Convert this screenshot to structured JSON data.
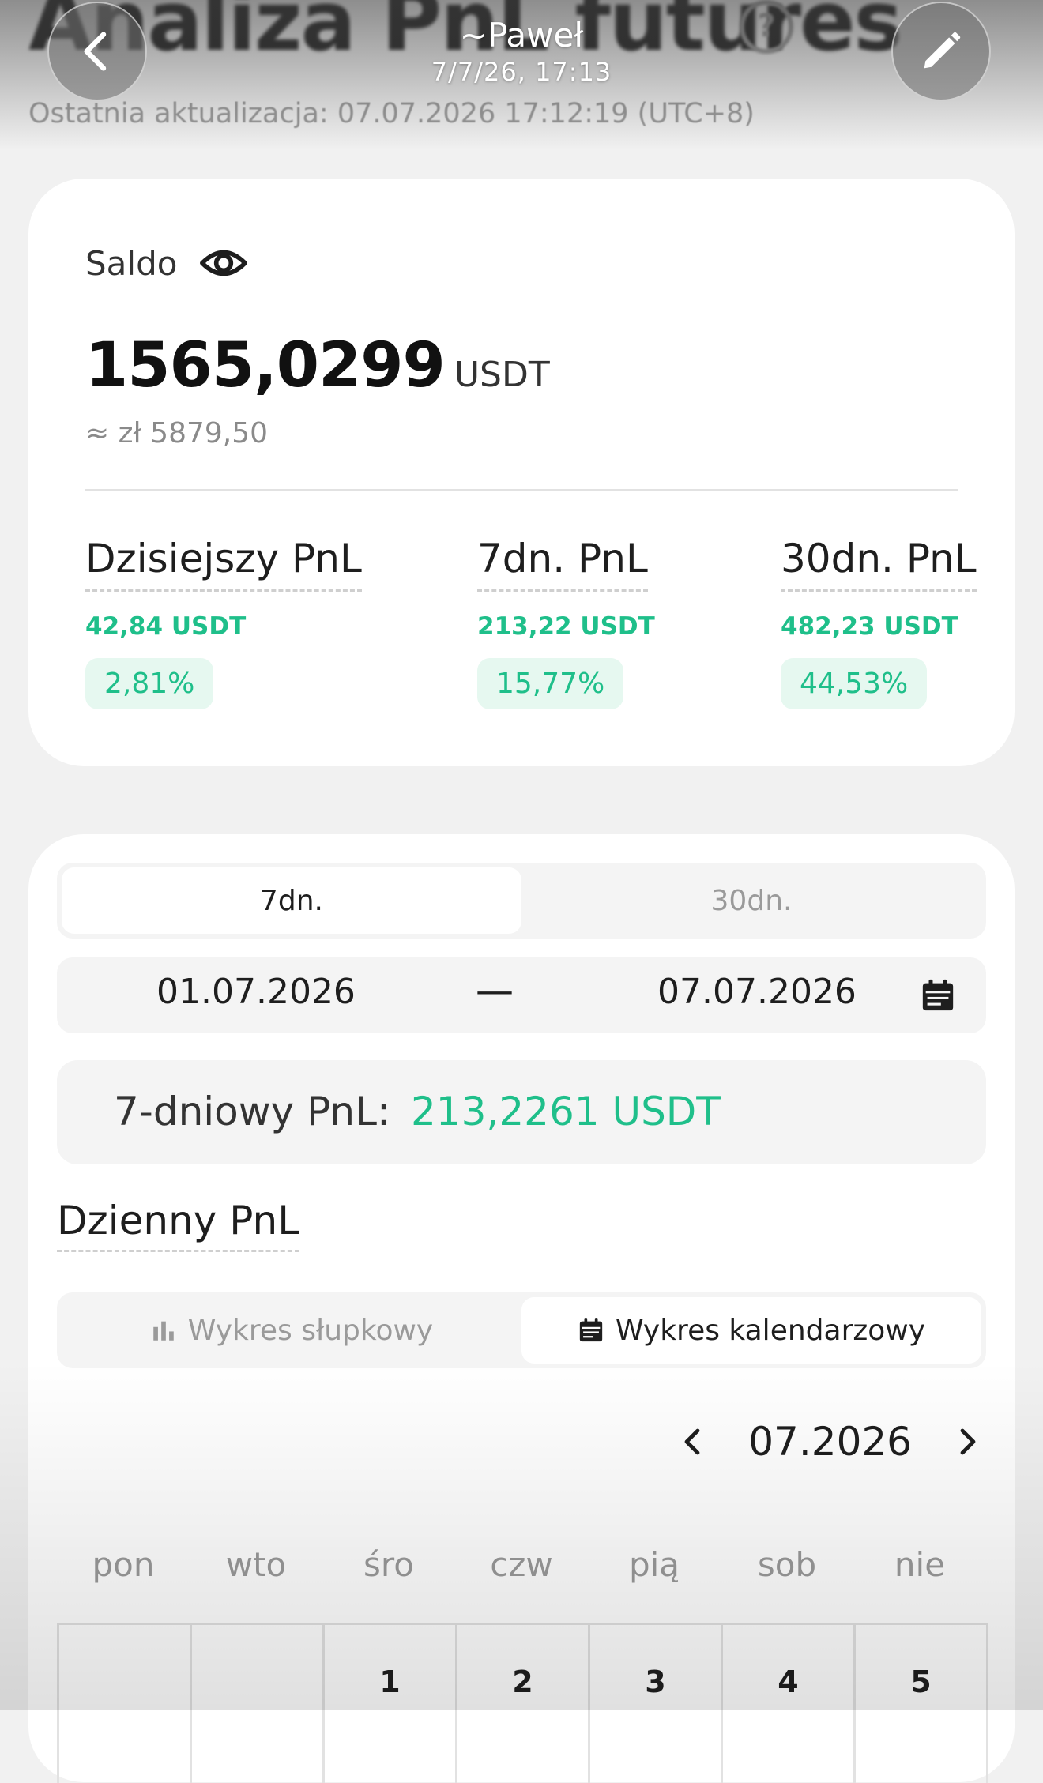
{
  "background_header": {
    "title": "Analiza PnL futures",
    "help_glyph": "?",
    "last_updated": "Ostatnia aktualizacja: 07.07.2026 17:12:19  (UTC+8)"
  },
  "story": {
    "user": "~Paweł",
    "time": "7/7/26, 17:13"
  },
  "balance": {
    "label": "Saldo",
    "value": "1565,0299",
    "unit": "USDT",
    "approx": "≈ zł 5879,50"
  },
  "pnl_summary": [
    {
      "title": "Dzisiejszy PnL",
      "value": "42,84 USDT",
      "percent": "2,81%"
    },
    {
      "title": "7dn. PnL",
      "value": "213,22 USDT",
      "percent": "15,77%"
    },
    {
      "title": "30dn. PnL",
      "value": "482,23 USDT",
      "percent": "44,53%"
    }
  ],
  "range_tabs": {
    "active": "7dn.",
    "inactive": "30dn."
  },
  "date_range": {
    "from": "01.07.2026",
    "separator": "—",
    "to": "07.07.2026"
  },
  "period_total": {
    "label": "7-dniowy PnL:",
    "value": "213,2261 USDT"
  },
  "daily": {
    "title": "Dzienny PnL",
    "bar_chart_label": "Wykres słupkowy",
    "calendar_chart_label": "Wykres kalendarzowy",
    "month": "07.2026",
    "weekdays": [
      "pon",
      "wto",
      "śro",
      "czw",
      "pią",
      "sob",
      "nie"
    ],
    "first_week": [
      "",
      "",
      "1",
      "2",
      "3",
      "4",
      "5"
    ]
  },
  "colors": {
    "positive": "#1fbf8a",
    "positive_bg": "#e6f8f0"
  },
  "icons": [
    "back-icon",
    "edit-icon",
    "help-icon",
    "eye-icon",
    "calendar-icon",
    "bar-chart-icon",
    "chevron-left-icon",
    "chevron-right-icon"
  ]
}
